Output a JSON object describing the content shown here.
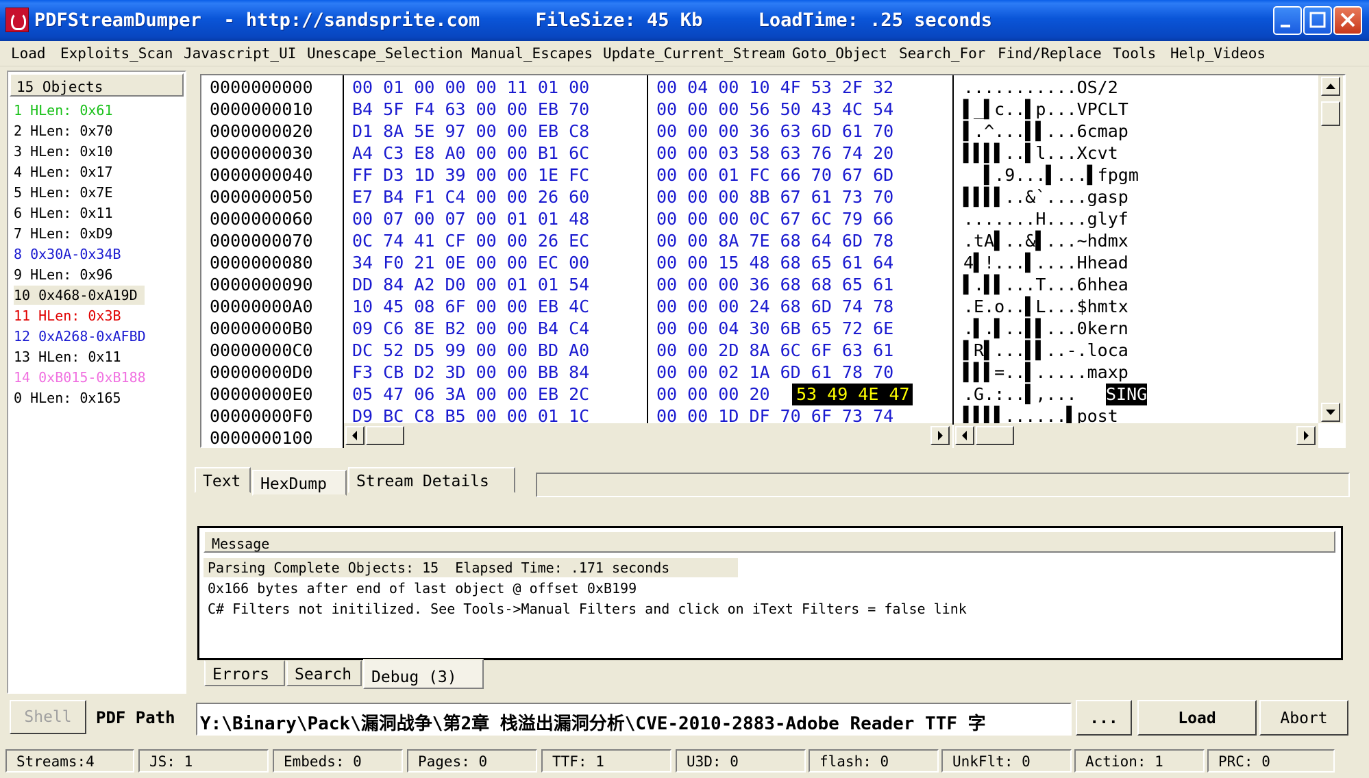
{
  "window": {
    "title": "PDFStreamDumper  - http://sandsprite.com     FileSize: 45 Kb     LoadTime: .25 seconds"
  },
  "menu": [
    "Load",
    "Exploits_Scan",
    "Javascript_UI",
    "Unescape_Selection",
    "Manual_Escapes",
    "Update_Current_Stream",
    "Goto_Object",
    "Search_For",
    "Find/Replace",
    "Tools",
    "Help_Videos"
  ],
  "objects": {
    "header": "15 Objects",
    "items": [
      {
        "label": "1 HLen: 0x61",
        "color": "#18c018"
      },
      {
        "label": "2 HLen: 0x70",
        "color": "#000000"
      },
      {
        "label": "3 HLen: 0x10",
        "color": "#000000"
      },
      {
        "label": "4 HLen: 0x17",
        "color": "#000000"
      },
      {
        "label": "5 HLen: 0x7E",
        "color": "#000000"
      },
      {
        "label": "6 HLen: 0x11",
        "color": "#000000"
      },
      {
        "label": "7 HLen: 0xD9",
        "color": "#000000"
      },
      {
        "label": "8 0x30A-0x34B",
        "color": "#1a1ad0"
      },
      {
        "label": "9 HLen: 0x96",
        "color": "#000000"
      },
      {
        "label": "10 0x468-0xA19D",
        "color": "#000000",
        "selected": true
      },
      {
        "label": "11 HLen: 0x3B",
        "color": "#e00000"
      },
      {
        "label": "12 0xA268-0xAFBD",
        "color": "#1a1ad0"
      },
      {
        "label": "13 HLen: 0x11",
        "color": "#000000"
      },
      {
        "label": "14 0xB015-0xB188",
        "color": "#f070e0"
      },
      {
        "label": "0 HLen: 0x165",
        "color": "#000000"
      }
    ]
  },
  "hexdump": {
    "rows": [
      {
        "offset": "0000000000",
        "b1": "00 01 00 00 00 11 01 00",
        "b2": "00 04 00 10 4F 53 2F 32",
        "ascii": "...........OS/2"
      },
      {
        "offset": "0000000010",
        "b1": "B4 5F F4 63 00 00 EB 70",
        "b2": "00 00 00 56 50 43 4C 54",
        "ascii": "▌_▌c..▌p...VPCLT"
      },
      {
        "offset": "0000000020",
        "b1": "D1 8A 5E 97 00 00 EB C8",
        "b2": "00 00 00 36 63 6D 61 70",
        "ascii": "▌.^...▌▌...6cmap"
      },
      {
        "offset": "0000000030",
        "b1": "A4 C3 E8 A0 00 00 B1 6C",
        "b2": "00 00 03 58 63 76 74 20",
        "ascii": "▌▌▌▌..▌l...Xcvt "
      },
      {
        "offset": "0000000040",
        "b1": "FF D3 1D 39 00 00 1E FC",
        "b2": "00 00 01 FC 66 70 67 6D",
        "ascii": "  ▌.9...▌...▌fpgm"
      },
      {
        "offset": "0000000050",
        "b1": "E7 B4 F1 C4 00 00 26 60",
        "b2": "00 00 00 8B 67 61 73 70",
        "ascii": "▌▌▌▌..&`....gasp"
      },
      {
        "offset": "0000000060",
        "b1": "00 07 00 07 00 01 01 48",
        "b2": "00 00 00 0C 67 6C 79 66",
        "ascii": ".......H....glyf"
      },
      {
        "offset": "0000000070",
        "b1": "0C 74 41 CF 00 00 26 EC",
        "b2": "00 00 8A 7E 68 64 6D 78",
        "ascii": ".tA▌..&▌...~hdmx"
      },
      {
        "offset": "0000000080",
        "b1": "34 F0 21 0E 00 00 EC 00",
        "b2": "00 00 15 48 68 65 61 64",
        "ascii": "4▌!...▌....Hhead"
      },
      {
        "offset": "0000000090",
        "b1": "DD 84 A2 D0 00 01 01 54",
        "b2": "00 00 00 36 68 68 65 61",
        "ascii": "▌.▌▌...T...6hhea"
      },
      {
        "offset": "00000000A0",
        "b1": "10 45 08 6F 00 00 EB 4C",
        "b2": "00 00 00 24 68 6D 74 78",
        "ascii": ".E.o..▌L...$hmtx"
      },
      {
        "offset": "00000000B0",
        "b1": "09 C6 8E B2 00 00 B4 C4",
        "b2": "00 00 04 30 6B 65 72 6E",
        "ascii": ".▌.▌..▌▌...0kern"
      },
      {
        "offset": "00000000C0",
        "b1": "DC 52 D5 99 00 00 BD A0",
        "b2": "00 00 2D 8A 6C 6F 63 61",
        "ascii": "▌R▌...▌▌..-.loca"
      },
      {
        "offset": "00000000D0",
        "b1": "F3 CB D2 3D 00 00 BB 84",
        "b2": "00 00 02 1A 6D 61 78 70",
        "ascii": "▌▌▌=..▌.....maxp"
      },
      {
        "offset": "00000000E0",
        "b1": "05 47 06 3A 00 00 EB 2C",
        "b2": "00 00 00 20",
        "b2hl": "53 49 4E 47",
        "ascii": ".G.:..▌,... ",
        "asciihl": "SING"
      },
      {
        "offset": "00000000F0",
        "b1": "D9 BC C8 B5 00 00 01 1C",
        "b2": "00 00 1D DF 70 6F 73 74",
        "ascii": "▌▌▌▌......▌post"
      },
      {
        "offset": "0000000100",
        "b1": "",
        "b2": "",
        "ascii": ""
      }
    ]
  },
  "tabs": {
    "text": "Text",
    "hexdump": "HexDump",
    "stream_details": "Stream Details"
  },
  "messages": {
    "header": "Message",
    "lines": [
      "Parsing Complete Objects: 15  Elapsed Time: .171 seconds",
      "0x166 bytes after end of last object @ offset 0xB199",
      "C# Filters not initilized. See Tools->Manual Filters and click on iText Filters = false link"
    ]
  },
  "bottom_tabs": {
    "errors": "Errors",
    "search": "Search",
    "debug": "Debug (3)"
  },
  "path_bar": {
    "shell_label": "Shell",
    "path_label": "PDF Path",
    "path_value": "Y:\\Binary\\Pack\\漏洞战争\\第2章 栈溢出漏洞分析\\CVE-2010-2883-Adobe Reader TTF 字",
    "browse_label": "...",
    "load_label": "Load",
    "abort_label": "Abort"
  },
  "status": {
    "streams": "Streams:4",
    "js": "JS: 1",
    "embeds": "Embeds: 0",
    "pages": "Pages: 0",
    "ttf": "TTF: 1",
    "u3d": "U3D: 0",
    "flash": "flash: 0",
    "unkflt": "UnkFlt: 0",
    "action": "Action: 1",
    "prc": "PRC: 0"
  }
}
